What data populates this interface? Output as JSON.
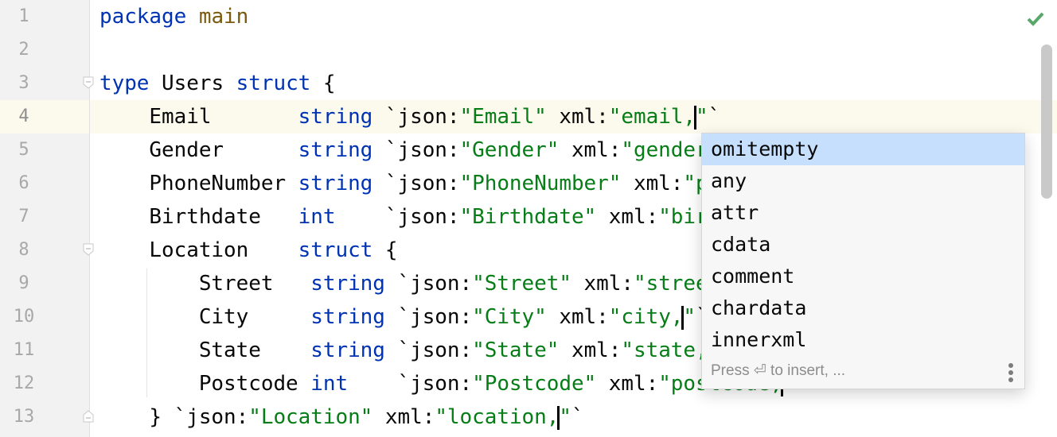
{
  "editor": {
    "line_numbers": [
      "1",
      "2",
      "3",
      "4",
      "5",
      "6",
      "7",
      "8",
      "9",
      "10",
      "11",
      "12",
      "13"
    ],
    "current_line": 4,
    "lines": [
      [
        {
          "t": "package",
          "c": "kw"
        },
        {
          "t": " ",
          "c": "plain"
        },
        {
          "t": "main",
          "c": "pkg"
        }
      ],
      [],
      [
        {
          "t": "type",
          "c": "kw"
        },
        {
          "t": " Users ",
          "c": "plain"
        },
        {
          "t": "struct",
          "c": "kw"
        },
        {
          "t": " {",
          "c": "plain"
        }
      ],
      [
        {
          "t": "    Email       ",
          "c": "plain"
        },
        {
          "t": "string",
          "c": "kw"
        },
        {
          "t": " `json:",
          "c": "plain"
        },
        {
          "t": "\"Email\"",
          "c": "str"
        },
        {
          "t": " xml:",
          "c": "plain"
        },
        {
          "t": "\"email,",
          "c": "str"
        },
        {
          "t": "",
          "c": "caret"
        },
        {
          "t": "\"",
          "c": "str"
        },
        {
          "t": "`",
          "c": "plain"
        }
      ],
      [
        {
          "t": "    Gender      ",
          "c": "plain"
        },
        {
          "t": "string",
          "c": "kw"
        },
        {
          "t": " `json:",
          "c": "plain"
        },
        {
          "t": "\"Gender\"",
          "c": "str"
        },
        {
          "t": " xml:",
          "c": "plain"
        },
        {
          "t": "\"gender,",
          "c": "str"
        },
        {
          "t": "",
          "c": "caret"
        },
        {
          "t": "\"",
          "c": "str"
        },
        {
          "t": "`",
          "c": "plain"
        }
      ],
      [
        {
          "t": "    PhoneNumber ",
          "c": "plain"
        },
        {
          "t": "string",
          "c": "kw"
        },
        {
          "t": " `json:",
          "c": "plain"
        },
        {
          "t": "\"PhoneNumber\"",
          "c": "str"
        },
        {
          "t": " xml:",
          "c": "plain"
        },
        {
          "t": "\"phonenumber,",
          "c": "str"
        },
        {
          "t": "",
          "c": "caret"
        },
        {
          "t": "\"",
          "c": "str"
        },
        {
          "t": "`",
          "c": "plain"
        }
      ],
      [
        {
          "t": "    Birthdate   ",
          "c": "plain"
        },
        {
          "t": "int",
          "c": "kw"
        },
        {
          "t": "    `json:",
          "c": "plain"
        },
        {
          "t": "\"Birthdate\"",
          "c": "str"
        },
        {
          "t": " xml:",
          "c": "plain"
        },
        {
          "t": "\"birthdate,",
          "c": "str"
        },
        {
          "t": "",
          "c": "caret"
        },
        {
          "t": "\"",
          "c": "str"
        },
        {
          "t": "`",
          "c": "plain"
        }
      ],
      [
        {
          "t": "    Location    ",
          "c": "plain"
        },
        {
          "t": "struct",
          "c": "kw"
        },
        {
          "t": " {",
          "c": "plain"
        }
      ],
      [
        {
          "t": "        Street   ",
          "c": "plain"
        },
        {
          "t": "string",
          "c": "kw"
        },
        {
          "t": " `json:",
          "c": "plain"
        },
        {
          "t": "\"Street\"",
          "c": "str"
        },
        {
          "t": " xml:",
          "c": "plain"
        },
        {
          "t": "\"street,",
          "c": "str"
        },
        {
          "t": "",
          "c": "caret"
        },
        {
          "t": "\"",
          "c": "str"
        },
        {
          "t": "`",
          "c": "plain"
        }
      ],
      [
        {
          "t": "        City     ",
          "c": "plain"
        },
        {
          "t": "string",
          "c": "kw"
        },
        {
          "t": " `json:",
          "c": "plain"
        },
        {
          "t": "\"City\"",
          "c": "str"
        },
        {
          "t": " xml:",
          "c": "plain"
        },
        {
          "t": "\"city,",
          "c": "str"
        },
        {
          "t": "",
          "c": "caret"
        },
        {
          "t": "\"",
          "c": "str"
        },
        {
          "t": "`",
          "c": "plain"
        }
      ],
      [
        {
          "t": "        State    ",
          "c": "plain"
        },
        {
          "t": "string",
          "c": "kw"
        },
        {
          "t": " `json:",
          "c": "plain"
        },
        {
          "t": "\"State\"",
          "c": "str"
        },
        {
          "t": " xml:",
          "c": "plain"
        },
        {
          "t": "\"state,",
          "c": "str"
        },
        {
          "t": "",
          "c": "caret"
        },
        {
          "t": "\"",
          "c": "str"
        },
        {
          "t": "`",
          "c": "plain"
        }
      ],
      [
        {
          "t": "        Postcode ",
          "c": "plain"
        },
        {
          "t": "int",
          "c": "kw"
        },
        {
          "t": "    `json:",
          "c": "plain"
        },
        {
          "t": "\"Postcode\"",
          "c": "str"
        },
        {
          "t": " xml:",
          "c": "plain"
        },
        {
          "t": "\"postcode,",
          "c": "str"
        },
        {
          "t": "",
          "c": "caret"
        },
        {
          "t": "\"",
          "c": "str"
        },
        {
          "t": "`",
          "c": "plain"
        }
      ],
      [
        {
          "t": "    } `json:",
          "c": "plain"
        },
        {
          "t": "\"Location\"",
          "c": "str"
        },
        {
          "t": " xml:",
          "c": "plain"
        },
        {
          "t": "\"location,",
          "c": "str"
        },
        {
          "t": "",
          "c": "caret"
        },
        {
          "t": "\"",
          "c": "str"
        },
        {
          "t": "`",
          "c": "plain"
        }
      ]
    ]
  },
  "status": {
    "inspection_icon": "checkmark-icon",
    "inspection_color": "#59a869"
  },
  "completion_popup": {
    "items": [
      "omitempty",
      "any",
      "attr",
      "cdata",
      "comment",
      "chardata",
      "innerxml"
    ],
    "selected_index": 0,
    "footer_hint": "Press ⏎ to insert, ...",
    "more_icon": "vertical-ellipsis-icon"
  },
  "colors": {
    "keyword": "#0033b3",
    "package_name": "#7a5a0f",
    "string": "#067d17",
    "selection": "#c5dffc",
    "current_line": "#fcfaed"
  }
}
